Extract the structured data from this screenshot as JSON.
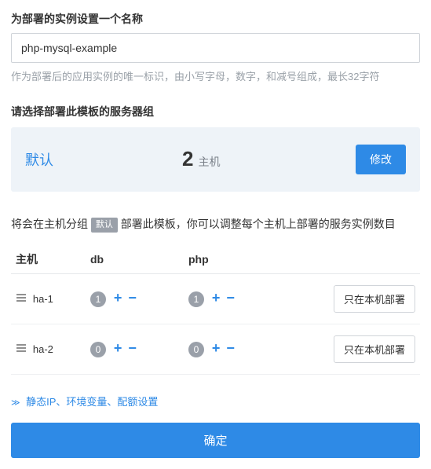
{
  "name_section": {
    "label": "为部署的实例设置一个名称",
    "value": "php-mysql-example",
    "help": "作为部署后的应用实例的唯一标识，由小写字母，数字，和减号组成，最长32字符"
  },
  "server_group": {
    "label": "请选择部署此模板的服务器组",
    "default_label": "默认",
    "host_count": "2",
    "host_unit": "主机",
    "modify_label": "修改"
  },
  "deploy": {
    "note_before": "将会在主机分组 ",
    "badge": "默认",
    "note_after": " 部署此模板，你可以调整每个主机上部署的服务实例数目",
    "columns": {
      "host": "主机",
      "svc1": "db",
      "svc2": "php"
    },
    "rows": [
      {
        "host": "ha-1",
        "db": "1",
        "php": "1",
        "action": "只在本机部署"
      },
      {
        "host": "ha-2",
        "db": "0",
        "php": "0",
        "action": "只在本机部署"
      }
    ]
  },
  "expand": {
    "caret": "≫",
    "label": "静态IP、环境变量、配额设置"
  },
  "confirm": "确定"
}
